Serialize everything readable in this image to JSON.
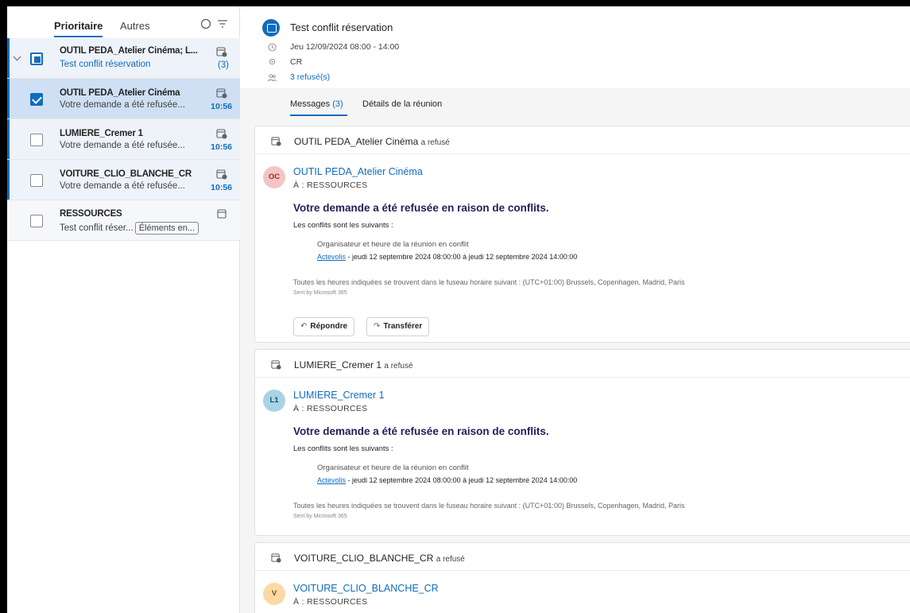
{
  "list": {
    "tabs": {
      "focused": "Prioritaire",
      "other": "Autres"
    },
    "items": [
      {
        "sender": "OUTIL PEDA_Atelier Cinéma; L...",
        "subject": "Test conflit réservation",
        "count": "(3)"
      },
      {
        "sender": "OUTIL PEDA_Atelier Cinéma",
        "subject": "Votre demande a été refusée...",
        "time": "10:56"
      },
      {
        "sender": "LUMIERE_Cremer 1",
        "subject": "Votre demande a été refusée...",
        "time": "10:56"
      },
      {
        "sender": "VOITURE_CLIO_BLANCHE_CR",
        "subject": "Votre demande a été refusée...",
        "time": "10:56"
      },
      {
        "sender": "RESSOURCES",
        "subject": "Test conflit réser...",
        "pill": "Éléments en..."
      }
    ]
  },
  "reading": {
    "title": "Test conflit réservation",
    "datetime": "Jeu 12/09/2024 08:00 - 14:00",
    "location": "CR",
    "attendees": "3 refusé(s)",
    "tabs": {
      "messages_label": "Messages",
      "messages_count": "(3)",
      "details_label": "Détails de la réunion"
    },
    "cards": [
      {
        "header_name": "OUTIL PEDA_Atelier Cinéma",
        "header_suffix": "a refusé",
        "initials": "OC",
        "from": "OUTIL PEDA_Atelier Cinéma",
        "to": "À :  RESSOURCES",
        "title": "Votre demande a été refusée en raison de conflits.",
        "sub": "Les conflits sont les suivants :",
        "org_heading": "Organisateur et heure de la réunion en conflit",
        "org_link": "Actevolis",
        "org_detail": " - jeudi 12 septembre 2024 08:00:00 à jeudi 12 septembre 2024 14:00:00",
        "tz": "Toutes les heures indiquées se trouvent dans le fuseau horaire suivant : (UTC+01:00) Brussels, Copenhagen, Madrid, Paris",
        "sent": "Sent by Microsoft 365",
        "reply": "Répondre",
        "forward": "Transférer"
      },
      {
        "header_name": "LUMIERE_Cremer 1",
        "header_suffix": "a refusé",
        "initials": "L1",
        "from": "LUMIERE_Cremer 1",
        "to": "À :  RESSOURCES",
        "title": "Votre demande a été refusée en raison de conflits.",
        "sub": "Les conflits sont les suivants :",
        "org_heading": "Organisateur et heure de la réunion en conflit",
        "org_link": "Actevolis",
        "org_detail": " - jeudi 12 septembre 2024 08:00:00 à jeudi 12 septembre 2024 14:00:00",
        "tz": "Toutes les heures indiquées se trouvent dans le fuseau horaire suivant : (UTC+01:00) Brussels, Copenhagen, Madrid, Paris",
        "sent": "Sent by Microsoft 365"
      },
      {
        "header_name": "VOITURE_CLIO_BLANCHE_CR",
        "header_suffix": "a refusé",
        "initials": "V",
        "from": "VOITURE_CLIO_BLANCHE_CR",
        "to": "À :  RESSOURCES"
      }
    ]
  },
  "colors": {
    "accent": "#0f6cbd",
    "selected_row": "#cfe0f4",
    "title_navy": "#1f1f5c"
  },
  "icons": [
    "chevron-down-icon",
    "filter-icon",
    "select-icon",
    "calendar-declined-icon",
    "calendar-icon",
    "clock-icon",
    "location-icon",
    "people-icon",
    "reply-icon",
    "forward-icon"
  ]
}
